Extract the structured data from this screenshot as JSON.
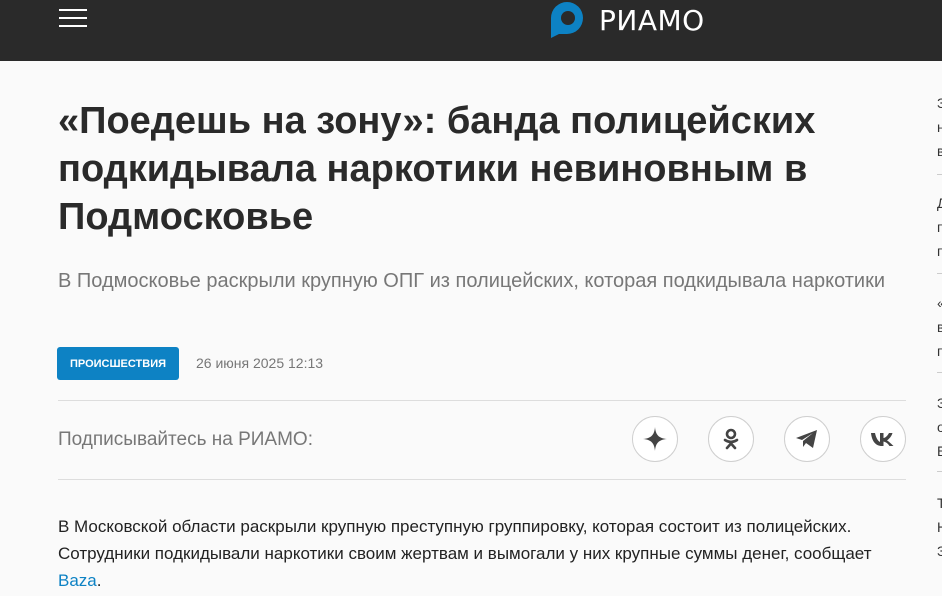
{
  "header": {
    "logo_text": "РИАМО",
    "logo_color": "#0d82c4",
    "menu_icon": "hamburger-menu-icon"
  },
  "article": {
    "title": "«Поедешь на зону»: банда полицейских подкидывала наркотики невиновным в Подмосковье",
    "subtitle": "В Подмосковье раскрыли крупную ОПГ из полицейских, которая подкидывала наркотики",
    "category": "Происшествия",
    "date": "26 июня 2025 12:13",
    "subscribe_label": "Подписывайтесь на РИАМО:",
    "social": [
      {
        "name": "dzen",
        "icon": "sparkle-icon"
      },
      {
        "name": "odnoklassniki",
        "icon": "ok-icon"
      },
      {
        "name": "telegram",
        "icon": "paper-plane-icon"
      },
      {
        "name": "vk",
        "icon": "vk-icon"
      }
    ],
    "body_before_link": "В Московской области раскрыли крупную преступную группировку, которая состоит из полицейских. Сотрудники подкидывали наркотики своим жертвам и вымогали у них крупные суммы денег, сообщает ",
    "source_link": "Baza",
    "body_after_link": "."
  },
  "sidebar": {
    "items": [
      {
        "text": "З\nн\nв"
      },
      {
        "text": "Д\nп\nп"
      },
      {
        "text": "«\nв\nп"
      },
      {
        "text": "З\nо\nБ"
      },
      {
        "text": "Т\nН\nЗ"
      }
    ]
  },
  "colors": {
    "header_bg": "#2a2a2a",
    "accent": "#0d82c4",
    "page_bg": "#fafafa"
  }
}
